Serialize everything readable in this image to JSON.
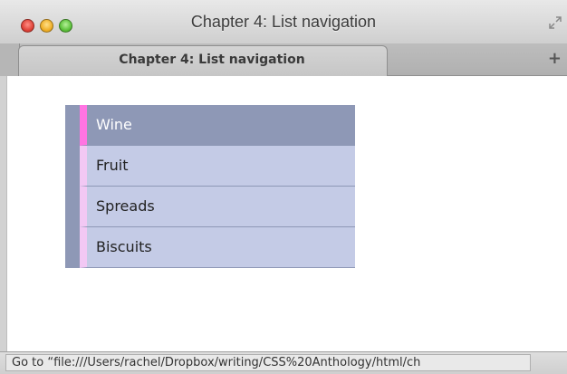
{
  "window": {
    "title": "Chapter 4: List navigation"
  },
  "tabs": [
    {
      "label": "Chapter 4: List navigation",
      "active": true
    }
  ],
  "new_tab_label": "+",
  "nav": {
    "items": [
      {
        "label": "Wine",
        "active": true
      },
      {
        "label": "Fruit",
        "active": false
      },
      {
        "label": "Spreads",
        "active": false
      },
      {
        "label": "Biscuits",
        "active": false
      }
    ]
  },
  "status": {
    "text": "Go to “file:///Users/rachel/Dropbox/writing/CSS%20Anthology/html/ch"
  },
  "colors": {
    "nav_background": "#8e98b6",
    "nav_item_background": "#c4cbe6",
    "active_marker": "#ff74e2",
    "item_marker": "#f2c8f4"
  }
}
